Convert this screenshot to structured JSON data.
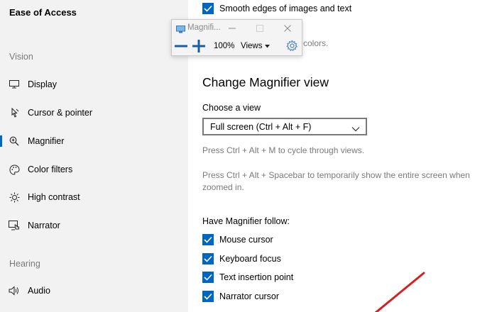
{
  "sidebar": {
    "title": "Ease of Access",
    "section_vision": "Vision",
    "section_hearing": "Hearing",
    "items": [
      {
        "label": "Display",
        "icon": "display-icon"
      },
      {
        "label": "Cursor & pointer",
        "icon": "cursor-pointer-icon"
      },
      {
        "label": "Magnifier",
        "icon": "magnifier-icon",
        "active": true
      },
      {
        "label": "Color filters",
        "icon": "color-filters-icon"
      },
      {
        "label": "High contrast",
        "icon": "high-contrast-icon"
      },
      {
        "label": "Narrator",
        "icon": "narrator-icon"
      },
      {
        "label": "Audio",
        "icon": "audio-icon"
      }
    ]
  },
  "main": {
    "smooth_edges_label": "Smooth edges of images and text",
    "partial_hidden_text": "colors.",
    "heading": "Change Magnifier view",
    "choose_view_label": "Choose a view",
    "view_selected": "Full screen (Ctrl + Alt + F)",
    "hint_cycle": "Press Ctrl + Alt + M to cycle through views.",
    "hint_spacebar": "Press Ctrl + Alt + Spacebar to temporarily show the entire screen when zoomed in.",
    "follow_label": "Have Magnifier follow:",
    "follow_options": [
      {
        "label": "Mouse cursor",
        "checked": true
      },
      {
        "label": "Keyboard focus",
        "checked": true
      },
      {
        "label": "Text insertion point",
        "checked": true
      },
      {
        "label": "Narrator cursor",
        "checked": true
      }
    ]
  },
  "magnifier_window": {
    "title": "Magnifi...",
    "zoom_level": "100%",
    "views_label": "Views"
  },
  "colors": {
    "accent": "#0067c0",
    "annotation_red": "#d42020"
  }
}
